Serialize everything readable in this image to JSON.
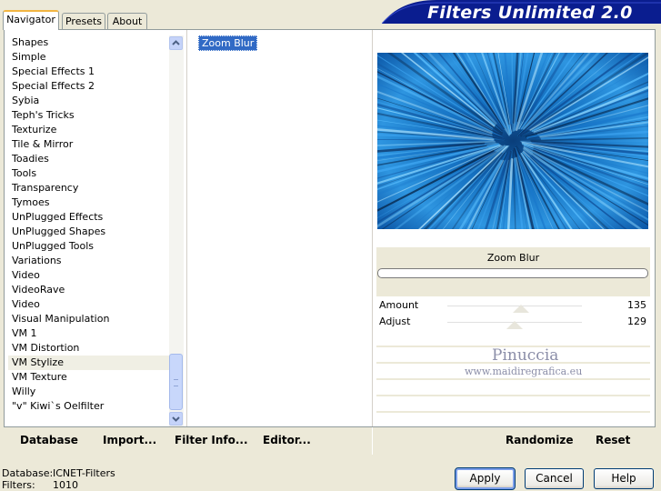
{
  "tabs": [
    {
      "label": "Navigator",
      "active": true
    },
    {
      "label": "Presets",
      "active": false
    },
    {
      "label": "About",
      "active": false
    }
  ],
  "header": {
    "title": "Filters Unlimited 2.0"
  },
  "categories": [
    "Shapes",
    "Simple",
    "Special Effects 1",
    "Special Effects 2",
    "Sybia",
    "Teph's Tricks",
    "Texturize",
    "Tile & Mirror",
    "Toadies",
    "Tools",
    "Transparency",
    "Tymoes",
    "UnPlugged Effects",
    "UnPlugged Shapes",
    "UnPlugged Tools",
    "Variations",
    "Video",
    "VideoRave",
    "Video",
    "Visual Manipulation",
    "VM 1",
    "VM Distortion",
    "VM Stylize",
    "VM Texture",
    "Willy",
    "\"v\" Kiwi`s Oelfilter"
  ],
  "selected_category": "VM Stylize",
  "filters": [
    "Zoom Blur"
  ],
  "preview": {
    "filter_name": "Zoom Blur",
    "progress_percent": 0
  },
  "params": [
    {
      "label": "Amount",
      "value": "135",
      "slider_fraction": 0.53
    },
    {
      "label": "Adjust",
      "value": "129",
      "slider_fraction": 0.51
    }
  ],
  "watermark": {
    "line1": "Pinuccia",
    "line2": "www.maidiregrafica.eu"
  },
  "toolbar": {
    "database": "Database",
    "import": "Import...",
    "filter_info": "Filter Info...",
    "editor": "Editor...",
    "randomize": "Randomize",
    "reset": "Reset"
  },
  "status": {
    "database_label": "Database:",
    "database_value": "ICNET-Filters",
    "filters_label": "Filters:",
    "filters_value": "1010"
  },
  "dialog": {
    "apply": "Apply",
    "cancel": "Cancel",
    "help": "Help"
  },
  "colors": {
    "selection": "#316AC5",
    "banner": "#0A1D8F",
    "accent_tab": "#F2B542"
  }
}
